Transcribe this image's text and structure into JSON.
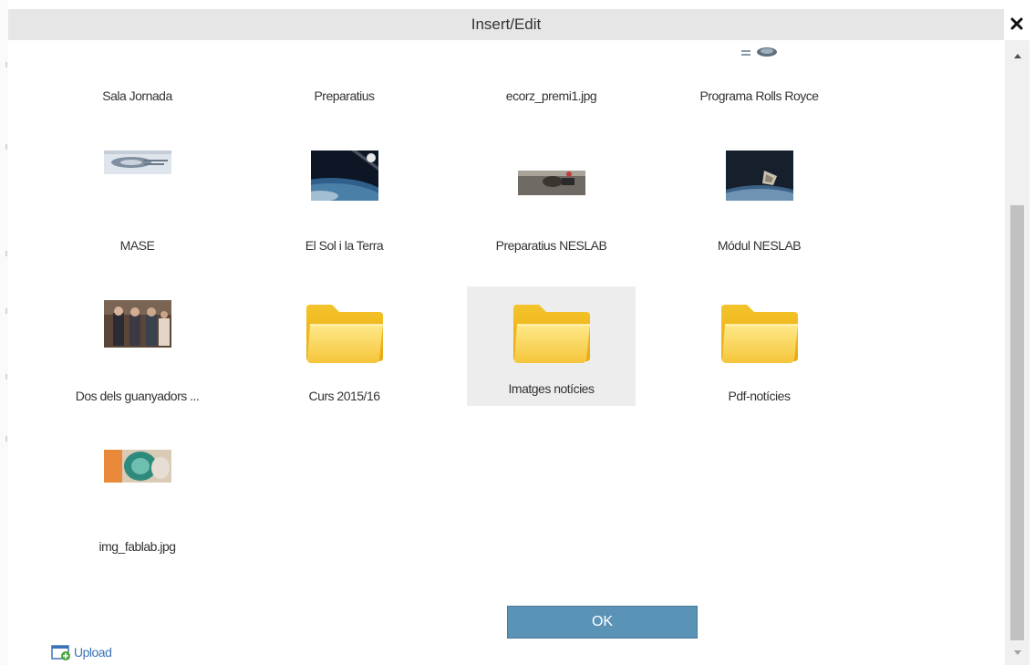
{
  "dialog": {
    "title": "Insert/Edit",
    "ok_label": "OK",
    "upload_label": "Upload"
  },
  "items": [
    {
      "label": "Sala Jornada",
      "type": "image"
    },
    {
      "label": "Preparatius",
      "type": "image"
    },
    {
      "label": "ecorz_premi1.jpg",
      "type": "image"
    },
    {
      "label": "Programa Rolls Royce",
      "type": "image"
    },
    {
      "label": "MASE",
      "type": "image"
    },
    {
      "label": "El Sol i la Terra",
      "type": "image"
    },
    {
      "label": "Preparatius NESLAB",
      "type": "image"
    },
    {
      "label": "Módul NESLAB",
      "type": "image"
    },
    {
      "label": "Dos dels guanyadors ...",
      "type": "image"
    },
    {
      "label": "Curs 2015/16",
      "type": "folder"
    },
    {
      "label": "Imatges notícies",
      "type": "folder",
      "selected": true
    },
    {
      "label": "Pdf-notícies",
      "type": "folder"
    },
    {
      "label": "img_fablab.jpg",
      "type": "image"
    }
  ],
  "colors": {
    "titlebar": "#e6e6e6",
    "ok_button": "#5b93b7",
    "link": "#3a73b8",
    "selected_bg": "#ededed",
    "folder": "#f7c531"
  },
  "icons": {
    "close": "close-icon",
    "upload": "upload-icon",
    "folder": "folder-icon",
    "scroll_up": "arrow-up-icon",
    "scroll_down": "arrow-down-icon"
  }
}
